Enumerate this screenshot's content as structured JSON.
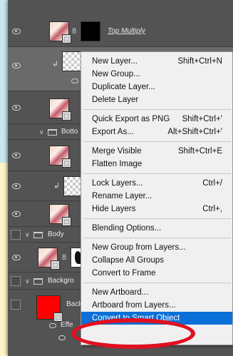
{
  "layers": {
    "top_multiply_name": "Top Multiply",
    "bottom_group_name": "Botto",
    "body_group_name": "Body",
    "background_group_name": "Backgro",
    "back_layer_name": "Back",
    "effects_label": "Effe",
    "chain_glyph": "8",
    "badge_glyph": "⬚"
  },
  "context_menu": {
    "groups": [
      [
        {
          "label": "New Layer...",
          "shortcut": "Shift+Ctrl+N"
        },
        {
          "label": "New Group...",
          "shortcut": ""
        },
        {
          "label": "Duplicate Layer...",
          "shortcut": ""
        },
        {
          "label": "Delete Layer",
          "shortcut": ""
        }
      ],
      [
        {
          "label": "Quick Export as PNG",
          "shortcut": "Shift+Ctrl+'"
        },
        {
          "label": "Export As...",
          "shortcut": "Alt+Shift+Ctrl+'"
        }
      ],
      [
        {
          "label": "Merge Visible",
          "shortcut": "Shift+Ctrl+E"
        },
        {
          "label": "Flatten Image",
          "shortcut": ""
        }
      ],
      [
        {
          "label": "Lock Layers...",
          "shortcut": "Ctrl+/"
        },
        {
          "label": "Rename Layer...",
          "shortcut": ""
        },
        {
          "label": "Hide Layers",
          "shortcut": "Ctrl+,"
        }
      ],
      [
        {
          "label": "Blending Options...",
          "shortcut": ""
        }
      ],
      [
        {
          "label": "New Group from Layers...",
          "shortcut": ""
        },
        {
          "label": "Collapse All Groups",
          "shortcut": ""
        },
        {
          "label": "Convert to Frame",
          "shortcut": ""
        }
      ],
      [
        {
          "label": "New Artboard...",
          "shortcut": ""
        },
        {
          "label": "Artboard from Layers...",
          "shortcut": ""
        },
        {
          "label": "Convert to Smart Object",
          "shortcut": "",
          "highlighted": true
        }
      ]
    ]
  },
  "colors": {
    "menu_highlight": "#0a6fd6",
    "annotation": "#e01020",
    "panel_bg": "#535353",
    "menu_bg": "#f0f0f0"
  }
}
